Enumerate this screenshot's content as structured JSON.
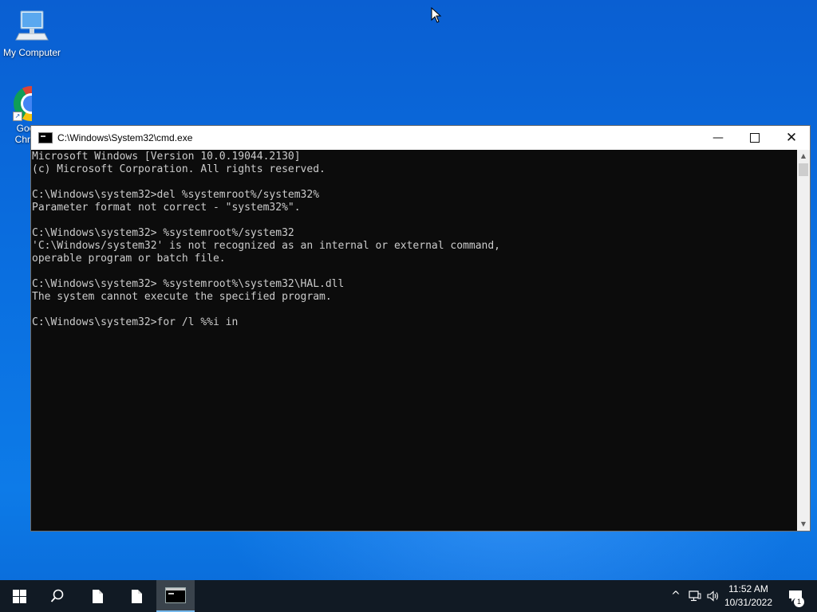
{
  "desktop": {
    "icons": [
      {
        "label": "My Computer",
        "icon": "computer-icon"
      },
      {
        "label": "Google Chrome",
        "icon": "chrome-icon"
      }
    ]
  },
  "window": {
    "title": "C:\\Windows\\System32\\cmd.exe",
    "minimize_glyph": "—",
    "close_glyph": "✕",
    "console_lines": [
      "Microsoft Windows [Version 10.0.19044.2130]",
      "(c) Microsoft Corporation. All rights reserved.",
      "",
      "C:\\Windows\\system32>del %systemroot%/system32%",
      "Parameter format not correct - \"system32%\".",
      "",
      "C:\\Windows\\system32> %systemroot%/system32",
      "'C:\\Windows/system32' is not recognized as an internal or external command,",
      "operable program or batch file.",
      "",
      "C:\\Windows\\system32> %systemroot%\\system32\\HAL.dll",
      "The system cannot execute the specified program.",
      "",
      "C:\\Windows\\system32>for /l %%i in"
    ],
    "scroll_up_glyph": "▲",
    "scroll_down_glyph": "▼"
  },
  "taskbar": {
    "start_icon": "windows-logo-icon",
    "search_icon": "search-icon",
    "apps": [
      "file-icon",
      "file-icon",
      "cmd-icon"
    ],
    "tray": {
      "chevron_glyph": "^",
      "network_icon": "network-icon",
      "volume_icon": "volume-icon",
      "time": "11:52 AM",
      "date": "10/31/2022",
      "notification_count": "1"
    }
  }
}
